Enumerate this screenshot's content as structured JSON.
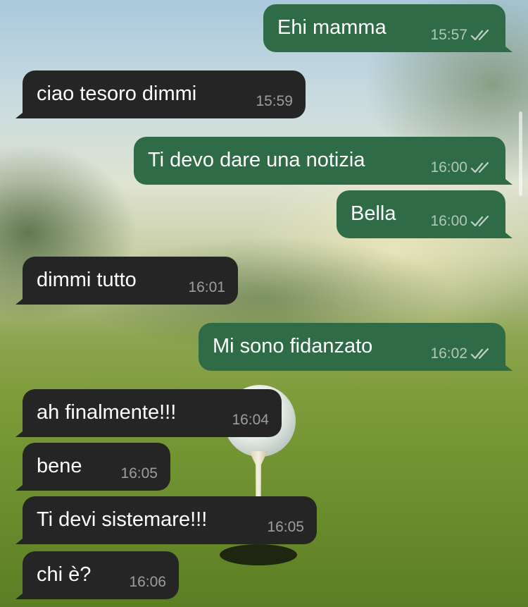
{
  "messages": [
    {
      "side": "out",
      "text": "Ehi mamma",
      "time": "15:57",
      "status": "read"
    },
    {
      "side": "in",
      "text": "ciao tesoro dimmi",
      "time": "15:59"
    },
    {
      "side": "out",
      "text": "Ti devo dare una notizia",
      "time": "16:00",
      "status": "read"
    },
    {
      "side": "out",
      "text": "Bella",
      "time": "16:00",
      "status": "read"
    },
    {
      "side": "in",
      "text": "dimmi tutto",
      "time": "16:01"
    },
    {
      "side": "out",
      "text": "Mi sono fidanzato",
      "time": "16:02",
      "status": "read"
    },
    {
      "side": "in",
      "text": "ah finalmente!!!",
      "time": "16:04"
    },
    {
      "side": "in",
      "text": "bene",
      "time": "16:05"
    },
    {
      "side": "in",
      "text": "Ti devi sistemare!!!",
      "time": "16:05"
    },
    {
      "side": "in",
      "text": "chi è?",
      "time": "16:06"
    }
  ],
  "colors": {
    "outgoing_bubble": "#2f6b47",
    "incoming_bubble": "#252525",
    "text": "#ffffff"
  },
  "icons": {
    "read_receipt": "double-check-icon"
  },
  "wallpaper": "golf-ball-on-tee-wallpaper"
}
